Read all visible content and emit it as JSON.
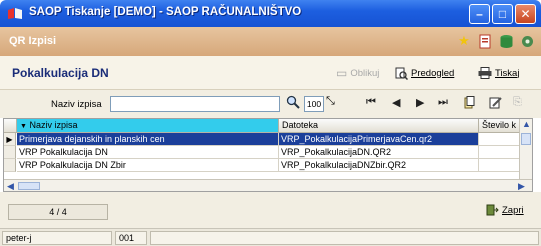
{
  "window": {
    "title": "SAOP Tiskanje [DEMO] - SAOP RAČUNALNIŠTVO",
    "minimize_glyph": "–",
    "maximize_glyph": "□",
    "close_glyph": "✕"
  },
  "panel": {
    "title": "QR Izpisi"
  },
  "form": {
    "title": "Pokalkulacija DN",
    "toolbar": {
      "design_label": "Oblikuj",
      "preview_label": "Predogled",
      "print_label": "Tiskaj"
    }
  },
  "filter": {
    "label": "Naziv izpisa",
    "value": "",
    "zoom": "100"
  },
  "grid": {
    "columns": [
      "Naziv izpisa",
      "Datoteka",
      "Število k"
    ],
    "rows": [
      {
        "naziv": "Primerjava dejanskih in planskih cen",
        "datoteka": "VRP_PokalkulacijaPrimerjavaCen.qr2",
        "stevilo": ""
      },
      {
        "naziv": "VRP Pokalkulacija DN",
        "datoteka": "VRP_PokalkulacijaDN.QR2",
        "stevilo": ""
      },
      {
        "naziv": "VRP Pokalkulacija DN Zbir",
        "datoteka": "VRP_PokalkulacijaDNZbir.QR2",
        "stevilo": ""
      }
    ],
    "selected_row": 0,
    "sort_indicator": "▼"
  },
  "footer": {
    "record_counter": "4 / 4",
    "close_label": "Zapri"
  },
  "status": {
    "user": "peter-j",
    "code": "001"
  },
  "colors": {
    "titlebar": "#1d5fe0",
    "panel": "#d6a77a",
    "selection": "#1b3f9a",
    "active_header": "#33ccec"
  }
}
